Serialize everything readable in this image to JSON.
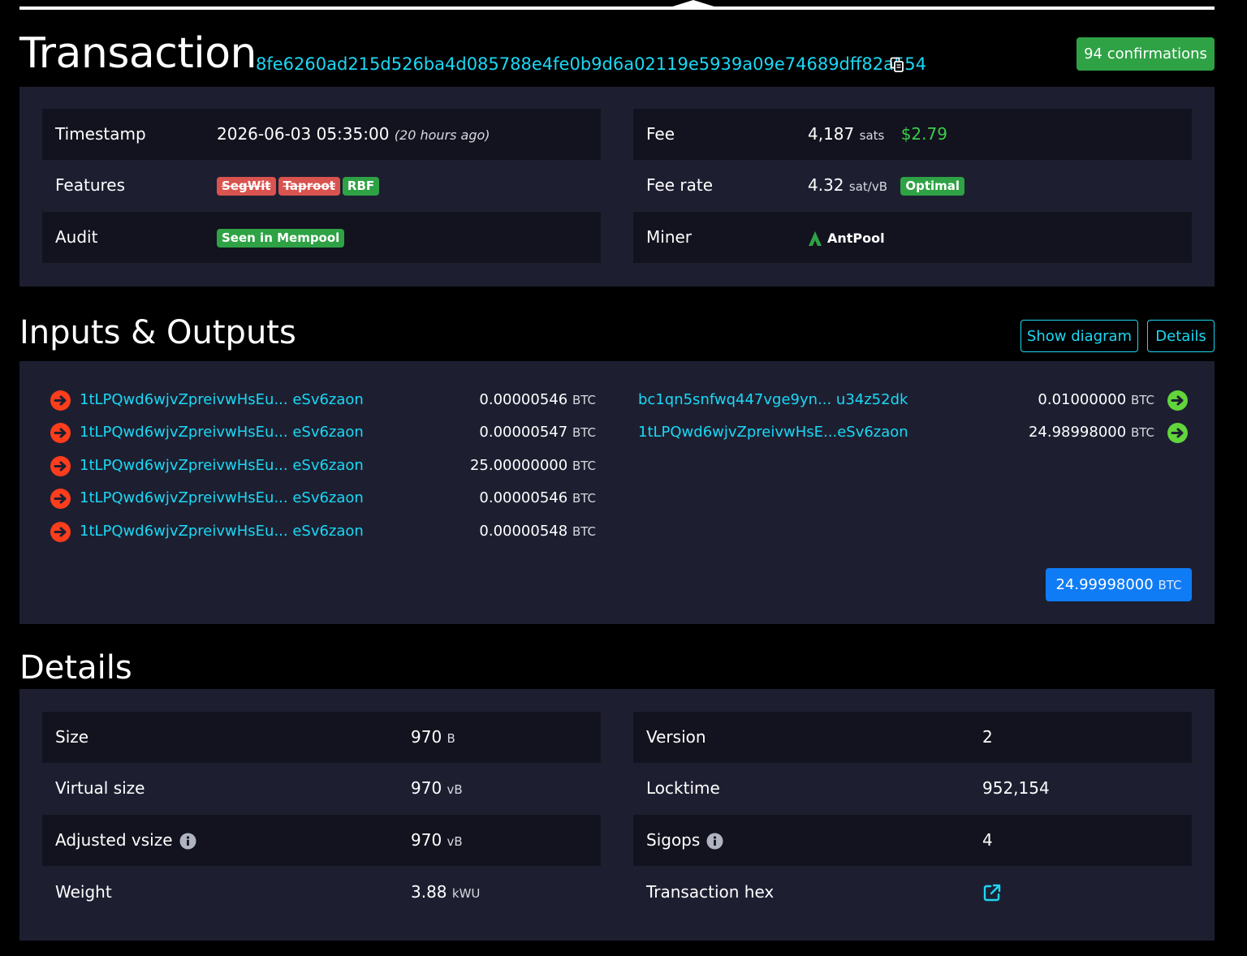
{
  "header": {
    "title": "Transaction",
    "txid": "8fe6260ad215d526ba4d085788e4fe0b9d6a02119e5939a09e74689dff82a554",
    "confirmations": "94 confirmations"
  },
  "summary": {
    "timestamp": {
      "label": "Timestamp",
      "value": "2026-06-03 05:35:00",
      "relative": "(20 hours ago)"
    },
    "features": {
      "label": "Features",
      "tags": [
        "SegWit",
        "Taproot",
        "RBF"
      ]
    },
    "audit": {
      "label": "Audit",
      "tag": "Seen in Mempool"
    },
    "fee": {
      "label": "Fee",
      "value": "4,187",
      "unit": "sats",
      "fiat": "$2.79"
    },
    "fee_rate": {
      "label": "Fee rate",
      "value": "4.32",
      "unit": "sat/vB",
      "tag": "Optimal"
    },
    "miner": {
      "label": "Miner",
      "name": "AntPool"
    }
  },
  "io": {
    "title": "Inputs & Outputs",
    "show_diagram_label": "Show diagram",
    "details_label": "Details",
    "inputs": [
      {
        "address": "1tLPQwd6wjvZpreivwHsEu... eSv6zaon",
        "amount": "0.00000546",
        "unit": "BTC"
      },
      {
        "address": "1tLPQwd6wjvZpreivwHsEu... eSv6zaon",
        "amount": "0.00000547",
        "unit": "BTC"
      },
      {
        "address": "1tLPQwd6wjvZpreivwHsEu... eSv6zaon",
        "amount": "25.00000000",
        "unit": "BTC"
      },
      {
        "address": "1tLPQwd6wjvZpreivwHsEu... eSv6zaon",
        "amount": "0.00000546",
        "unit": "BTC"
      },
      {
        "address": "1tLPQwd6wjvZpreivwHsEu... eSv6zaon",
        "amount": "0.00000548",
        "unit": "BTC"
      }
    ],
    "outputs": [
      {
        "address": "bc1qn5snfwq447vge9yn... u34z52dk",
        "amount": "0.01000000",
        "unit": "BTC"
      },
      {
        "address": "1tLPQwd6wjvZpreivwHsE...eSv6zaon",
        "amount": "24.98998000",
        "unit": "BTC"
      }
    ],
    "total": {
      "amount": "24.99998000",
      "unit": "BTC"
    }
  },
  "details": {
    "title": "Details",
    "size": {
      "label": "Size",
      "value": "970",
      "unit": "B"
    },
    "virtual_size": {
      "label": "Virtual size",
      "value": "970",
      "unit": "vB"
    },
    "adjusted_vsize": {
      "label": "Adjusted vsize",
      "value": "970",
      "unit": "vB"
    },
    "weight": {
      "label": "Weight",
      "value": "3.88",
      "unit": "kWU"
    },
    "version": {
      "label": "Version",
      "value": "2"
    },
    "locktime": {
      "label": "Locktime",
      "value": "952,154"
    },
    "sigops": {
      "label": "Sigops",
      "value": "4"
    },
    "tx_hex": {
      "label": "Transaction hex"
    }
  },
  "colors": {
    "accent": "#1bd8f4",
    "panel": "#1d1f31",
    "row_dark": "#12131e",
    "success": "#2ea244",
    "danger": "#d9534f",
    "primary": "#0f7cf5",
    "input_arrow": "#fd3d1c",
    "output_arrow": "#61d53b"
  }
}
